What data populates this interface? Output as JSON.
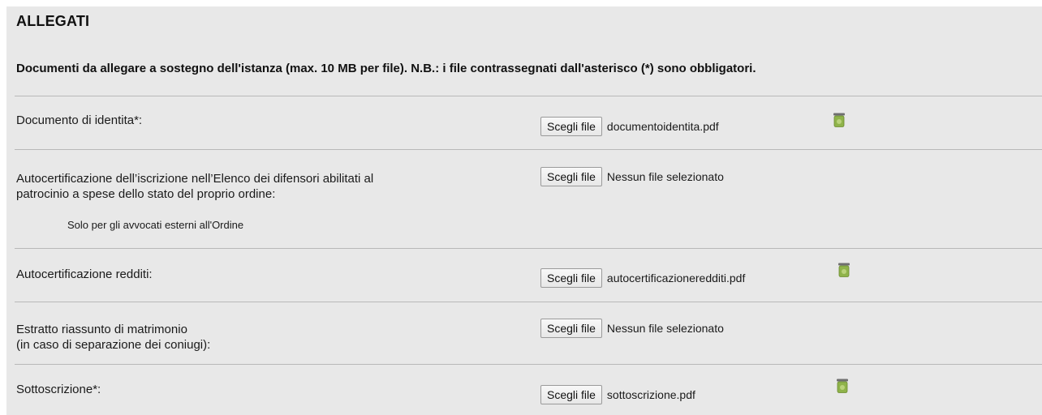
{
  "section": {
    "title": "ALLEGATI",
    "subtitle": "Documenti da allegare a sostegno dell'istanza (max. 10 MB per file). N.B.: i file contrassegnati dall'asterisco (*) sono obbligatori."
  },
  "rows": [
    {
      "label_lines": [
        "Documento di identita*:"
      ],
      "button_label": "Scegli file",
      "file_name": "documentoidentita.pdf",
      "has_delete_icon": true
    },
    {
      "label_lines": [
        "Autocertificazione dell’iscrizione nell’Elenco dei difensori abilitati al",
        "patrocinio a spese dello stato del proprio ordine:"
      ],
      "note": "Solo per gli avvocati esterni all'Ordine",
      "button_label": "Scegli file",
      "file_name": "Nessun file selezionato",
      "has_delete_icon": false
    },
    {
      "label_lines": [
        "Autocertificazione redditi:"
      ],
      "button_label": "Scegli file",
      "file_name": "autocertificazioneredditi.pdf",
      "has_delete_icon": true
    },
    {
      "label_lines": [
        "Estratto riassunto di matrimonio",
        "(in caso di separazione dei coniugi):"
      ],
      "button_label": "Scegli file",
      "file_name": "Nessun file selezionato",
      "has_delete_icon": false
    },
    {
      "label_lines": [
        "Sottoscrizione*:"
      ],
      "button_label": "Scegli file",
      "file_name": "sottoscrizione.pdf",
      "has_delete_icon": true
    }
  ],
  "icons": {
    "delete": "trash-bin-icon"
  },
  "colors": {
    "panel_background": "#e8e8e8",
    "divider": "#b8b8b8",
    "trash_green": "#8fb34a"
  }
}
